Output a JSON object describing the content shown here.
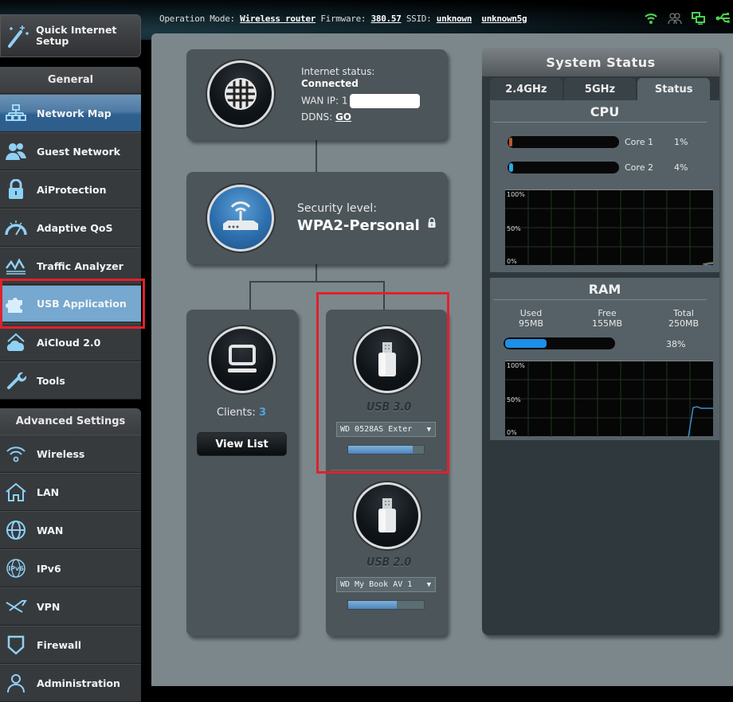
{
  "topbar": {
    "operation_mode_label": "Operation Mode:",
    "operation_mode_value": "Wireless router",
    "firmware_label": "Firmware:",
    "firmware_value": "380.57",
    "ssid_label": "SSID:",
    "ssid_values": [
      "unknown",
      "unknown5g"
    ],
    "status_icons": [
      "wifi-icon",
      "users-icon",
      "network-icon",
      "usb-icon"
    ],
    "status_icon_color": "#4fd14f"
  },
  "sidebar": {
    "quick_setup": "Quick Internet Setup",
    "quick_setup_lines": [
      "Quick Internet",
      "Setup"
    ],
    "general_header": "General",
    "general_items": [
      {
        "label": "Network Map",
        "icon": "network-map-icon",
        "state": "active"
      },
      {
        "label": "Guest Network",
        "icon": "guest-network-icon"
      },
      {
        "label": "AiProtection",
        "icon": "lock-icon"
      },
      {
        "label": "Adaptive QoS",
        "icon": "speedometer-icon"
      },
      {
        "label": "Traffic Analyzer",
        "icon": "traffic-chart-icon"
      },
      {
        "label": "USB Application",
        "icon": "puzzle-icon",
        "state": "highlighted"
      },
      {
        "label": "AiCloud 2.0",
        "icon": "cloud-house-icon"
      },
      {
        "label": "Tools",
        "icon": "wrench-icon"
      }
    ],
    "advanced_header": "Advanced Settings",
    "advanced_items": [
      {
        "label": "Wireless",
        "icon": "wifi-icon"
      },
      {
        "label": "LAN",
        "icon": "house-icon"
      },
      {
        "label": "WAN",
        "icon": "globe-icon"
      },
      {
        "label": "IPv6",
        "icon": "ipv6-globe-icon"
      },
      {
        "label": "VPN",
        "icon": "vpn-icon"
      },
      {
        "label": "Firewall",
        "icon": "shield-icon"
      },
      {
        "label": "Administration",
        "icon": "admin-user-icon"
      }
    ]
  },
  "network_map": {
    "internet": {
      "status_label": "Internet status:",
      "status_value": "Connected",
      "wan_ip_label": "WAN IP:",
      "wan_ip_prefix": "1",
      "ddns_label": "DDNS:",
      "ddns_link": "GO"
    },
    "router": {
      "security_label": "Security level:",
      "security_value": "WPA2-Personal"
    },
    "clients": {
      "label": "Clients:",
      "count": "3",
      "view_button": "View List"
    },
    "usb_ports": [
      {
        "label": "USB 3.0",
        "device": "WD 0528AS Exter",
        "usage_fraction": 0.85
      },
      {
        "label": "USB 2.0",
        "device": "WD My Book AV 1",
        "usage_fraction": 0.64
      }
    ]
  },
  "system_status": {
    "title": "System Status",
    "tabs": [
      {
        "label": "2.4GHz",
        "active": false
      },
      {
        "label": "5GHz",
        "active": false
      },
      {
        "label": "Status",
        "active": true
      }
    ],
    "cpu": {
      "title": "CPU",
      "cores": [
        {
          "label": "Core 1",
          "percent": 1,
          "value_text": "1%",
          "color": "#c0582a"
        },
        {
          "label": "Core 2",
          "percent": 4,
          "value_text": "4%",
          "color": "#2aa8e6"
        }
      ],
      "graph_labels": [
        "100%",
        "50%",
        "0%"
      ]
    },
    "ram": {
      "title": "RAM",
      "used_label": "Used",
      "used_value": "95MB",
      "free_label": "Free",
      "free_value": "155MB",
      "total_label": "Total",
      "total_value": "250MB",
      "percent": 38,
      "percent_text": "38%",
      "graph_labels": [
        "100%",
        "50%",
        "0%"
      ],
      "bar_color": "#1e8ee6"
    }
  }
}
